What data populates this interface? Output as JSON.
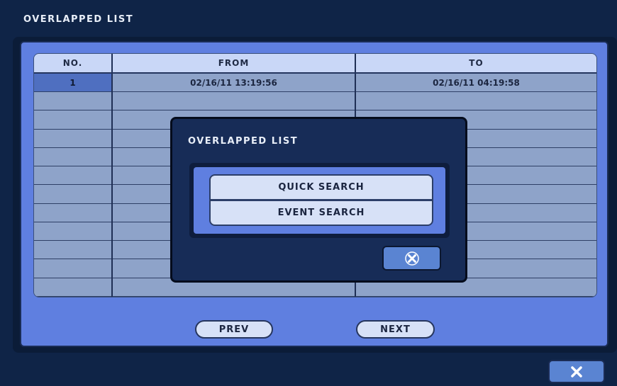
{
  "window": {
    "title": "OVERLAPPED LIST"
  },
  "table": {
    "headers": [
      "NO.",
      "FROM",
      "TO"
    ],
    "rows": [
      [
        "1",
        "02/16/11 13:19:56",
        "02/16/11 04:19:58"
      ],
      [
        "",
        "",
        ""
      ],
      [
        "",
        "",
        ""
      ],
      [
        "",
        "",
        ""
      ],
      [
        "",
        "",
        ""
      ],
      [
        "",
        "",
        ""
      ],
      [
        "",
        "",
        ""
      ],
      [
        "",
        "",
        ""
      ],
      [
        "",
        "",
        ""
      ],
      [
        "",
        "",
        ""
      ],
      [
        "",
        "",
        ""
      ],
      [
        "",
        "",
        ""
      ]
    ],
    "selected_row": 0
  },
  "buttons": {
    "prev": "PREV",
    "next": "NEXT",
    "close_icon": "close-x-icon"
  },
  "dialog": {
    "title": "OVERLAPPED LIST",
    "options": [
      "QUICK SEARCH",
      "EVENT SEARCH"
    ],
    "close_icon": "close-x-icon"
  },
  "colors": {
    "background": "#0f2447",
    "panel": "#5f7fe0",
    "cell": "#8ea3c9",
    "header": "#c9d7f7",
    "selected": "#4f6fc0"
  }
}
